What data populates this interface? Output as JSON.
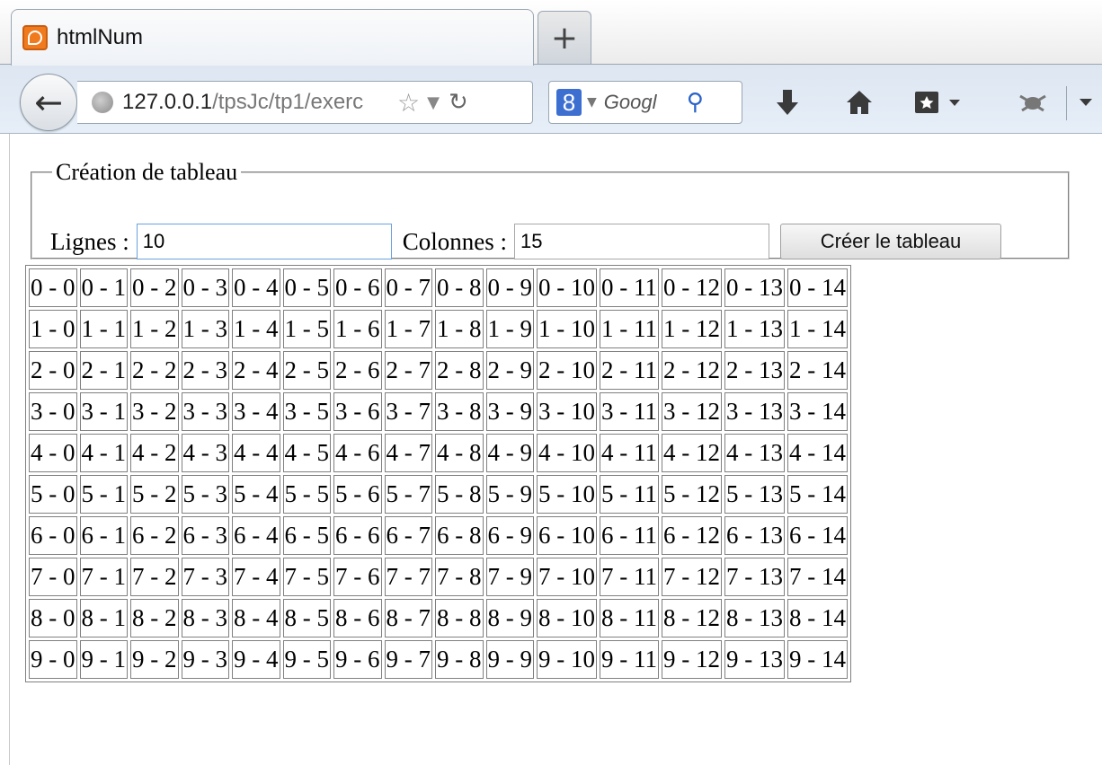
{
  "browser": {
    "tab_title": "htmlNum",
    "new_tab_label": "+",
    "back_label": "←",
    "url_host": "127.0.0.1",
    "url_path": "/tpsJc/tp1/exerc",
    "search_engine_label": "8",
    "search_placeholder": "Googl",
    "search_go": "⚲",
    "star": "☆",
    "dropdown": "▼",
    "reload": "↻"
  },
  "form": {
    "legend": "Création de tableau",
    "rows_label": "Lignes :",
    "rows_value": "10",
    "cols_label": "Colonnes :",
    "cols_value": "15",
    "submit_label": "Créer le tableau"
  },
  "table": {
    "rows": 10,
    "cols": 15,
    "separator": " - "
  },
  "icons": {
    "favicon": "xampp-icon",
    "download": "download-icon",
    "home": "home-icon",
    "bookmarks": "bookmarks-icon",
    "addon": "bug-icon",
    "menu": "menu-dropdown-icon"
  }
}
